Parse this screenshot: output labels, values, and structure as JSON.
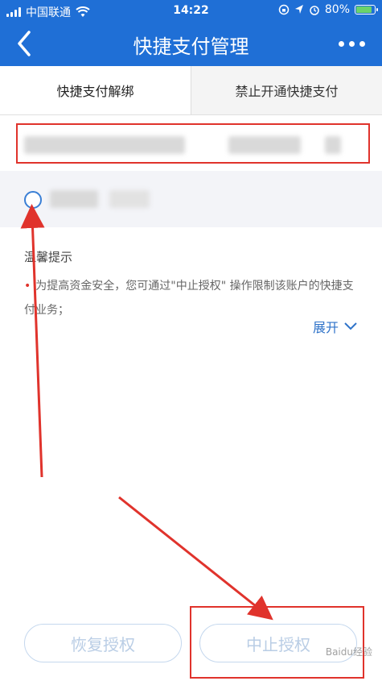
{
  "status_bar": {
    "carrier": "中国联通",
    "time": "14:22",
    "battery": "80%"
  },
  "nav": {
    "title": "快捷支付管理",
    "back_icon": "chevron-left-icon",
    "more_icon": "more-icon"
  },
  "tabs": [
    {
      "label": "快捷支付解绑",
      "active": true
    },
    {
      "label": "禁止开通快捷支付",
      "active": false
    }
  ],
  "tips": {
    "title": "温馨提示",
    "text": "为提高资金安全，您可通过\"中止授权\" 操作限制该账户的快捷支付业务；",
    "expand_label": "展开"
  },
  "buttons": {
    "restore_label": "恢复授权",
    "stop_label": "中止授权"
  },
  "watermark": "Baidu经验",
  "colors": {
    "brand_blue": "#1f6fd6",
    "annotation_red": "#e0332c",
    "link_blue": "#2f73c9"
  }
}
